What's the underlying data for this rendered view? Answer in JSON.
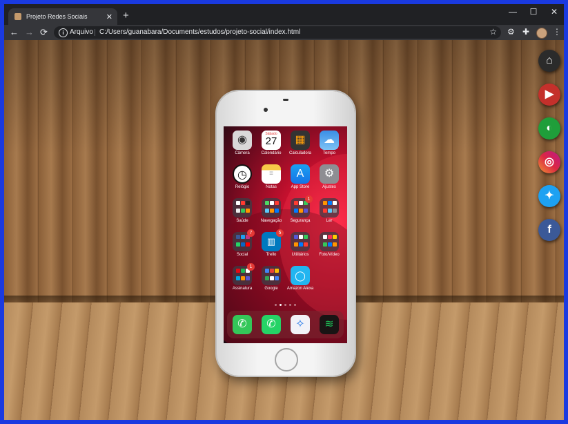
{
  "browser": {
    "tab_title": "Projeto Redes Sociais",
    "tab_close": "✕",
    "new_tab": "+",
    "minimize": "—",
    "maximize": "☐",
    "close": "✕",
    "back": "←",
    "forward": "→",
    "reload": "⟳",
    "scheme_label": "Arquivo",
    "url": "C:/Users/guanabara/Documents/estudos/projeto-social/index.html",
    "star": "☆",
    "menu": "⋮"
  },
  "phone": {
    "apps": [
      {
        "label": "Câmera",
        "icon": "camera-icon"
      },
      {
        "label": "Calendário",
        "icon": "calendar-icon",
        "day_name": "Sábado",
        "day": "27"
      },
      {
        "label": "Calculadora",
        "icon": "calculator-icon"
      },
      {
        "label": "Tempo",
        "icon": "weather-icon"
      },
      {
        "label": "Relógio",
        "icon": "clock-icon"
      },
      {
        "label": "Notas",
        "icon": "notes-icon"
      },
      {
        "label": "App Store",
        "icon": "app-store-icon"
      },
      {
        "label": "Ajustes",
        "icon": "settings-icon"
      },
      {
        "label": "Saúde",
        "icon": "folder-icon"
      },
      {
        "label": "Navegação",
        "icon": "folder-icon"
      },
      {
        "label": "Segurança",
        "icon": "folder-icon",
        "badge": "1"
      },
      {
        "label": "Ler",
        "icon": "folder-icon"
      },
      {
        "label": "Social",
        "icon": "folder-icon",
        "badge": "7"
      },
      {
        "label": "Trello",
        "icon": "trello-icon",
        "badge": "5"
      },
      {
        "label": "Utilitários",
        "icon": "folder-icon"
      },
      {
        "label": "Foto/Vídeo",
        "icon": "folder-icon"
      },
      {
        "label": "Assinatura",
        "icon": "folder-icon",
        "badge": "1"
      },
      {
        "label": "Google",
        "icon": "folder-icon"
      },
      {
        "label": "Amazon Alexa",
        "icon": "alexa-icon"
      }
    ],
    "dock": [
      "phone-icon",
      "whatsapp-icon",
      "safari-icon",
      "spotify-icon"
    ]
  },
  "social_links": [
    "home-icon",
    "youtube-icon",
    "github-icon",
    "instagram-icon",
    "twitter-icon",
    "facebook-icon"
  ],
  "colors": {
    "frame": "#1a3ae0",
    "youtube": "#c4302b",
    "github": "#1f9e3a",
    "twitter": "#1da1f2",
    "facebook": "#3b5998",
    "home": "#2b2b2b"
  }
}
